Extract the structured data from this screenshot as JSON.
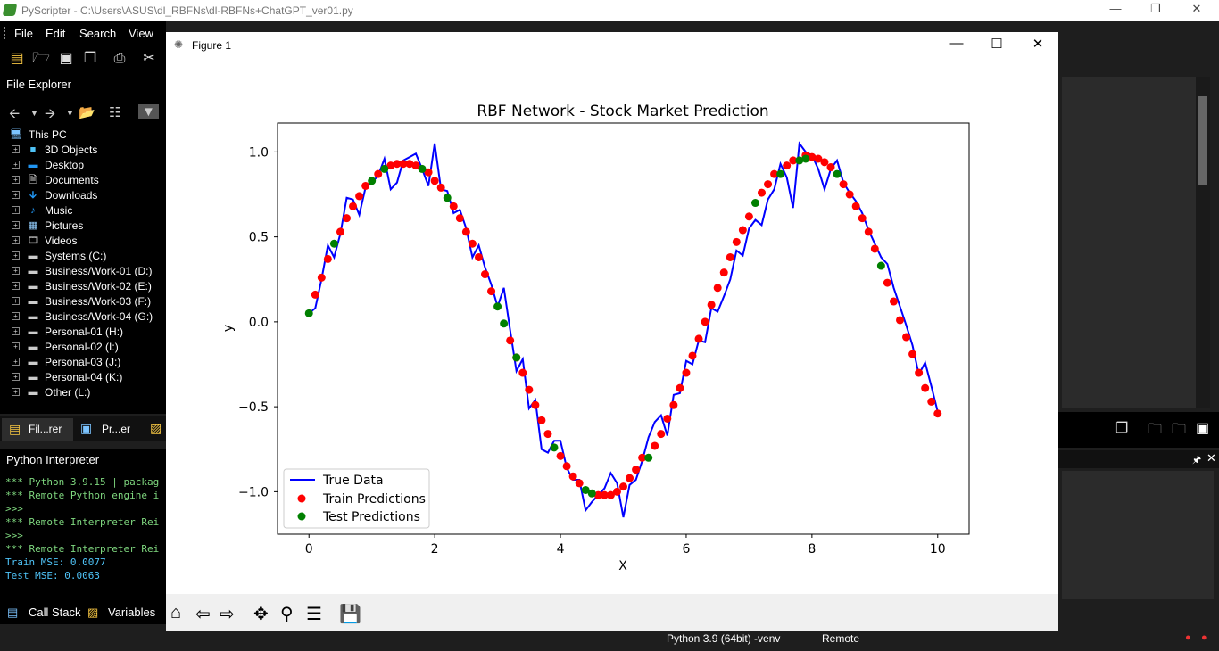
{
  "app": {
    "title": "PyScripter - C:\\Users\\ASUS\\dl_RBFNs\\dl-RBFNs+ChatGPT_ver01.py",
    "menu": [
      "File",
      "Edit",
      "Search",
      "View"
    ],
    "window_controls": [
      "—",
      "❐",
      "✕"
    ]
  },
  "file_explorer": {
    "title": "File Explorer",
    "items": [
      {
        "label": "This PC",
        "icon": "computer-icon"
      },
      {
        "label": "3D Objects",
        "icon": "cube-icon"
      },
      {
        "label": "Desktop",
        "icon": "desktop-icon"
      },
      {
        "label": "Documents",
        "icon": "document-icon"
      },
      {
        "label": "Downloads",
        "icon": "download-icon"
      },
      {
        "label": "Music",
        "icon": "music-icon"
      },
      {
        "label": "Pictures",
        "icon": "picture-icon"
      },
      {
        "label": "Videos",
        "icon": "video-icon"
      },
      {
        "label": "Systems (C:)",
        "icon": "drive-icon"
      },
      {
        "label": "Business/Work-01 (D:)",
        "icon": "drive-icon"
      },
      {
        "label": "Business/Work-02 (E:)",
        "icon": "drive-icon"
      },
      {
        "label": "Business/Work-03 (F:)",
        "icon": "drive-icon"
      },
      {
        "label": "Business/Work-04 (G:)",
        "icon": "drive-icon"
      },
      {
        "label": "Personal-01 (H:)",
        "icon": "drive-icon"
      },
      {
        "label": "Personal-02 (I:)",
        "icon": "drive-icon"
      },
      {
        "label": "Personal-03 (J:)",
        "icon": "drive-icon"
      },
      {
        "label": "Personal-04 (K:)",
        "icon": "drive-icon"
      },
      {
        "label": "Other (L:)",
        "icon": "drive-icon"
      }
    ],
    "tabs": [
      "Fil...rer",
      "Pr...er"
    ]
  },
  "interpreter": {
    "title": "Python Interpreter",
    "lines": [
      {
        "text": "*** Python 3.9.15 | packag",
        "color": "#7ed67e"
      },
      {
        "text": "*** Remote Python engine i",
        "color": "#7ed67e"
      },
      {
        "text": ">>>",
        "color": "#7ed67e"
      },
      {
        "text": "*** Remote Interpreter Rei",
        "color": "#7ed67e"
      },
      {
        "text": ">>>",
        "color": "#7ed67e"
      },
      {
        "text": "*** Remote Interpreter Rei",
        "color": "#7ed67e"
      },
      {
        "text": "Train MSE: 0.0077",
        "color": "#4fc3f7"
      },
      {
        "text": "Test MSE: 0.0063",
        "color": "#4fc3f7"
      }
    ],
    "bottom_tabs": [
      "Call Stack",
      "Variables"
    ]
  },
  "status": {
    "python": "Python 3.9 (64bit) -venv",
    "mode": "Remote"
  },
  "figure": {
    "title": "Figure 1",
    "window_controls": [
      "—",
      "☐",
      "✕"
    ],
    "toolbar": [
      "home-icon",
      "back-icon",
      "forward-icon",
      "pan-icon",
      "zoom-icon",
      "configure-icon",
      "save-icon"
    ]
  },
  "chart_data": {
    "type": "line",
    "title": "RBF Network - Stock Market Prediction",
    "xlabel": "X",
    "ylabel": "y",
    "xlim": [
      -0.5,
      10.5
    ],
    "ylim": [
      -1.25,
      1.17
    ],
    "xticks": [
      0,
      2,
      4,
      6,
      8,
      10
    ],
    "yticks": [
      -1.0,
      -0.5,
      0.0,
      0.5,
      1.0
    ],
    "legend": {
      "placement": "lower-left",
      "entries": [
        "True Data",
        "Train Predictions",
        "Test Predictions"
      ]
    },
    "colors": {
      "true": "#0000ff",
      "train": "#ff0000",
      "test": "#008000"
    },
    "series": [
      {
        "name": "True Data",
        "x": [
          0.0,
          0.1,
          0.2,
          0.3,
          0.4,
          0.5,
          0.6,
          0.7,
          0.8,
          0.9,
          1.0,
          1.1,
          1.2,
          1.3,
          1.4,
          1.5,
          1.6,
          1.7,
          1.8,
          1.9,
          2.0,
          2.1,
          2.2,
          2.3,
          2.4,
          2.5,
          2.6,
          2.7,
          2.8,
          2.9,
          3.0,
          3.1,
          3.2,
          3.3,
          3.4,
          3.5,
          3.6,
          3.7,
          3.8,
          3.9,
          4.0,
          4.1,
          4.2,
          4.3,
          4.4,
          4.5,
          4.6,
          4.7,
          4.8,
          4.9,
          5.0,
          5.1,
          5.2,
          5.3,
          5.4,
          5.5,
          5.6,
          5.7,
          5.8,
          5.9,
          6.0,
          6.1,
          6.2,
          6.3,
          6.4,
          6.5,
          6.6,
          6.7,
          6.8,
          6.9,
          7.0,
          7.1,
          7.2,
          7.3,
          7.4,
          7.5,
          7.6,
          7.7,
          7.8,
          7.9,
          8.0,
          8.1,
          8.2,
          8.3,
          8.4,
          8.5,
          8.6,
          8.7,
          8.8,
          8.9,
          9.0,
          9.1,
          9.2,
          9.3,
          9.4,
          9.5,
          9.6,
          9.7,
          9.8,
          9.9,
          10.0
        ],
        "y": [
          0.05,
          0.08,
          0.25,
          0.45,
          0.38,
          0.52,
          0.73,
          0.72,
          0.63,
          0.79,
          0.82,
          0.86,
          0.96,
          0.78,
          0.82,
          0.95,
          0.97,
          0.99,
          0.9,
          0.8,
          1.05,
          0.78,
          0.77,
          0.64,
          0.66,
          0.55,
          0.38,
          0.45,
          0.32,
          0.22,
          0.09,
          0.2,
          -0.05,
          -0.29,
          -0.22,
          -0.51,
          -0.46,
          -0.75,
          -0.77,
          -0.7,
          -0.7,
          -0.86,
          -0.93,
          -0.93,
          -1.11,
          -1.06,
          -1.02,
          -0.98,
          -0.89,
          -0.95,
          -1.15,
          -0.96,
          -0.93,
          -0.82,
          -0.68,
          -0.59,
          -0.55,
          -0.67,
          -0.43,
          -0.42,
          -0.23,
          -0.25,
          -0.11,
          -0.12,
          0.08,
          0.06,
          0.15,
          0.25,
          0.42,
          0.39,
          0.55,
          0.6,
          0.57,
          0.72,
          0.78,
          0.93,
          0.85,
          0.67,
          1.05,
          1.0,
          0.98,
          0.9,
          0.78,
          0.9,
          0.95,
          0.82,
          0.76,
          0.71,
          0.64,
          0.54,
          0.46,
          0.38,
          0.34,
          0.2,
          0.09,
          -0.02,
          -0.14,
          -0.31,
          -0.24,
          -0.38,
          -0.53
        ]
      },
      {
        "name": "Train Predictions",
        "x": [
          0.1,
          0.2,
          0.3,
          0.5,
          0.6,
          0.7,
          0.8,
          0.9,
          1.1,
          1.3,
          1.4,
          1.5,
          1.6,
          1.7,
          1.9,
          2.0,
          2.1,
          2.3,
          2.4,
          2.5,
          2.6,
          2.7,
          2.8,
          2.9,
          3.2,
          3.3,
          3.4,
          3.5,
          3.6,
          3.7,
          3.8,
          4.0,
          4.1,
          4.2,
          4.3,
          4.6,
          4.7,
          4.8,
          4.9,
          5.0,
          5.1,
          5.2,
          5.3,
          5.5,
          5.6,
          5.7,
          5.8,
          5.9,
          6.0,
          6.1,
          6.2,
          6.3,
          6.4,
          6.5,
          6.6,
          6.7,
          6.8,
          6.9,
          7.0,
          7.2,
          7.3,
          7.4,
          7.6,
          7.7,
          7.9,
          8.0,
          8.1,
          8.2,
          8.3,
          8.5,
          8.6,
          8.7,
          8.8,
          8.9,
          9.0,
          9.2,
          9.3,
          9.4,
          9.5,
          9.6,
          9.7,
          9.8,
          9.9,
          10.0
        ],
        "y": [
          0.16,
          0.26,
          0.37,
          0.53,
          0.61,
          0.68,
          0.74,
          0.8,
          0.87,
          0.92,
          0.93,
          0.93,
          0.93,
          0.92,
          0.88,
          0.83,
          0.79,
          0.68,
          0.61,
          0.53,
          0.46,
          0.38,
          0.28,
          0.18,
          -0.11,
          -0.21,
          -0.3,
          -0.4,
          -0.49,
          -0.58,
          -0.66,
          -0.79,
          -0.85,
          -0.91,
          -0.95,
          -1.02,
          -1.02,
          -1.02,
          -1.0,
          -0.97,
          -0.92,
          -0.87,
          -0.8,
          -0.73,
          -0.66,
          -0.57,
          -0.49,
          -0.39,
          -0.3,
          -0.2,
          -0.1,
          0.0,
          0.1,
          0.2,
          0.29,
          0.38,
          0.47,
          0.54,
          0.62,
          0.76,
          0.81,
          0.87,
          0.92,
          0.95,
          0.98,
          0.97,
          0.96,
          0.94,
          0.91,
          0.81,
          0.75,
          0.68,
          0.61,
          0.53,
          0.43,
          0.23,
          0.12,
          0.01,
          -0.09,
          -0.19,
          -0.3,
          -0.39,
          -0.47,
          -0.54
        ]
      },
      {
        "name": "Test Predictions",
        "x": [
          0.0,
          0.4,
          1.0,
          1.2,
          1.8,
          2.2,
          3.0,
          3.1,
          3.3,
          3.9,
          4.4,
          4.5,
          5.4,
          7.1,
          7.5,
          7.8,
          7.9,
          8.4,
          9.1
        ],
        "y": [
          0.05,
          0.46,
          0.83,
          0.9,
          0.9,
          0.73,
          0.09,
          -0.01,
          -0.21,
          -0.74,
          -0.99,
          -1.01,
          -0.8,
          0.7,
          0.87,
          0.95,
          0.96,
          0.87,
          0.33
        ]
      }
    ]
  }
}
